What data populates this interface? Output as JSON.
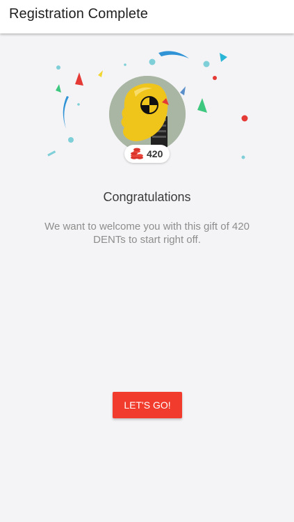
{
  "header": {
    "title": "Registration Complete"
  },
  "avatar": {
    "icon": "crash-test-dummy-icon"
  },
  "reward": {
    "icon": "coin-stack-icon",
    "amount": "420"
  },
  "message": {
    "heading": "Congratulations",
    "body": "We want to welcome you with this gift of 420 DENTs to start right off."
  },
  "action": {
    "label": "LET'S GO!"
  },
  "colors": {
    "accent": "#f03b2d",
    "background": "#f4f4f6",
    "confetti": [
      "#7fcfd8",
      "#e53935",
      "#f2d630",
      "#3ec77e",
      "#2f93d6",
      "#29b6d6"
    ]
  }
}
